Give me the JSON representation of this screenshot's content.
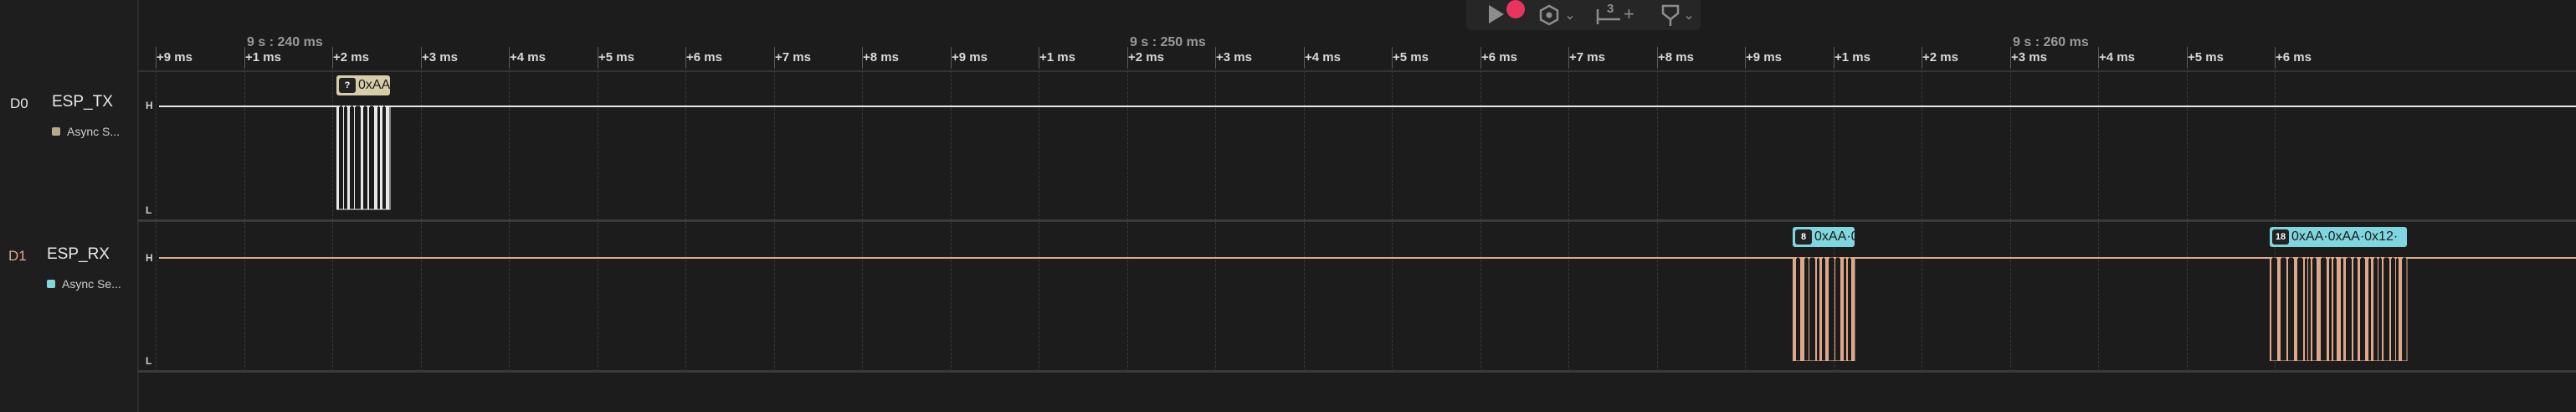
{
  "toolbar": {
    "play_icon": "play-icon",
    "record_icon": "record-icon",
    "trigger_icon": "trigger-icon",
    "measure_icon": "measure-icon",
    "measure_count": "3",
    "measure_plus": "+",
    "marker_icon": "marker-icon",
    "chevron": "⌄"
  },
  "timescale": {
    "major_labels": [
      "9 s : 240 ms",
      "9 s : 250 ms",
      "9 s : 260 ms"
    ],
    "minor_labels": [
      "+9 ms",
      "+1 ms",
      "+2 ms",
      "+3 ms",
      "+4 ms",
      "+5 ms",
      "+6 ms",
      "+7 ms",
      "+8 ms",
      "+9 ms",
      "+1 ms",
      "+2 ms",
      "+3 ms",
      "+4 ms",
      "+5 ms",
      "+6 ms",
      "+7 ms",
      "+8 ms",
      "+9 ms",
      "+1 ms",
      "+2 ms",
      "+3 ms",
      "+4 ms",
      "+5 ms",
      "+6 ms"
    ]
  },
  "channels": [
    {
      "number": "D0",
      "name": "ESP_TX",
      "analyzer": "Async S...",
      "color": "#e8e8e8",
      "analyzer_color": "#b7a98a",
      "high_label": "H",
      "low_label": "L",
      "frames": [
        {
          "badge": "?",
          "text": "0xAA",
          "color": "#d6cda9"
        }
      ]
    },
    {
      "number": "D1",
      "name": "ESP_RX",
      "analyzer": "Async Se...",
      "color": "#e0a88b",
      "analyzer_color": "#7fd6de",
      "high_label": "H",
      "low_label": "L",
      "frames": [
        {
          "badge": "8",
          "text": "0xAA·0",
          "color": "#7fd6de"
        },
        {
          "badge": "18",
          "text": "0xAA·0xAA·0x12·",
          "color": "#7fd6de"
        }
      ]
    }
  ]
}
